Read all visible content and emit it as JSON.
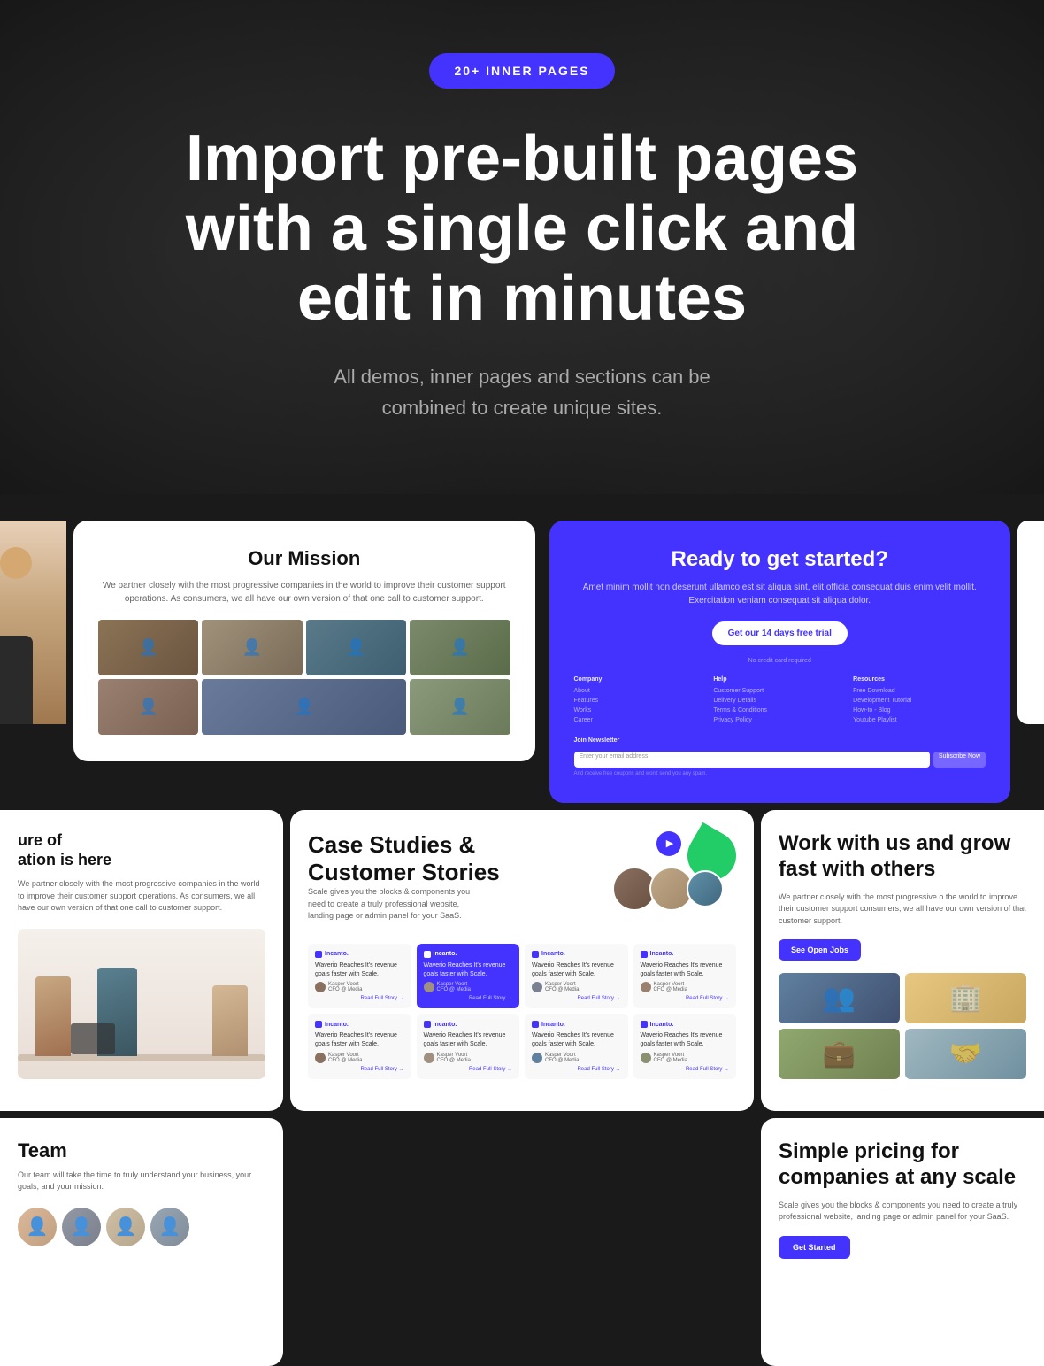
{
  "hero": {
    "badge": "20+ INNER PAGES",
    "title": "Import pre-built pages with a single click and edit in minutes",
    "subtitle": "All demos, inner pages and sections can be combined to create unique sites."
  },
  "card_mission": {
    "title": "Our Mission",
    "text": "We partner closely with the most progressive companies in the world to improve their customer support operations. As consumers, we all have our own version of that one call to customer support."
  },
  "card_ready": {
    "title": "Ready to get started?",
    "text": "Amet minim mollit non deserunt ullamco est sit aliqua sint, elit officia consequat duis enim velit mollit. Exercitation veniam consequat sit aliqua dolor.",
    "cta_button": "Get our 14 days free trial",
    "cta_sub": "No credit card required",
    "footer": {
      "company": {
        "header": "Company",
        "links": [
          "About",
          "Features",
          "Works",
          "Career"
        ]
      },
      "help": {
        "header": "Help",
        "links": [
          "Customer Support",
          "Delivery Details",
          "Terms & Conditions",
          "Privacy Policy"
        ]
      },
      "resources": {
        "header": "Resources",
        "links": [
          "Free Download",
          "Development Tutorial",
          "How-to - Blog",
          "Youtube Playlist"
        ]
      },
      "newsletter": {
        "header": "Join Newsletter",
        "placeholder": "Enter your email address",
        "button": "Subscribe Now",
        "note": "And receive free coupons and won't send you any spam."
      }
    }
  },
  "card_era": {
    "title": "ure of ation is here",
    "text": "We partner closely with the most progressive companies in the world to improve their customer support operations. As consumers, we all have our own version of that one call to customer support."
  },
  "card_case_studies": {
    "title": "Case Studies & Customer Stories",
    "desc": "Scale gives you the blocks & components you need to create a truly professional website, landing page or admin panel for your SaaS.",
    "testimonials": [
      {
        "brand": "Incanto.",
        "text": "Waverio Reaches It's revenue goals faster with Scale.",
        "author": "Kasper Voort",
        "role": "CFO @ Media",
        "read": "Read Full Story →",
        "highlighted": false
      },
      {
        "brand": "Incanto.",
        "text": "Waverio Reaches It's revenue goals faster with Scale.",
        "author": "Kasper Voort",
        "role": "CFO @ Media",
        "read": "Read Full Story →",
        "highlighted": true
      },
      {
        "brand": "Incanto.",
        "text": "Waverio Reaches It's revenue goals faster with Scale.",
        "author": "Kasper Voort",
        "role": "CFO @ Media",
        "read": "Read Full Story →",
        "highlighted": false
      },
      {
        "brand": "Incanto.",
        "text": "Waverio Reaches It's revenue goals faster with Scale.",
        "author": "Kasper Voort",
        "role": "CFO @ Media",
        "read": "Read Full Story →",
        "highlighted": false
      },
      {
        "brand": "Incanto.",
        "text": "Waverio Reaches It's revenue goals faster with Scale.",
        "author": "Kasper Voort",
        "role": "CFO @ Media",
        "read": "Read Full Story →",
        "highlighted": false
      },
      {
        "brand": "Incanto.",
        "text": "Waverio Reaches It's revenue goals faster with Scale.",
        "author": "Kasper Voort",
        "role": "CFO @ Media",
        "read": "Read Full Story →",
        "highlighted": false
      },
      {
        "brand": "Incanto.",
        "text": "Waverio Reaches It's revenue goals faster with Scale.",
        "author": "Kasper Voort",
        "role": "CFO @ Media",
        "read": "Read Full Story →",
        "highlighted": false
      },
      {
        "brand": "Incanto.",
        "text": "Waverio Reaches It's revenue goals faster with Scale.",
        "author": "Kasper Voort",
        "role": "CFO @ Media",
        "read": "Read Full Story →",
        "highlighted": false
      }
    ]
  },
  "card_work": {
    "title": "Work with us and grow fast with others",
    "text": "We partner closely with the most progressive o the world to improve their customer support consumers, we all have our own version of that customer support.",
    "button": "See Open Jobs"
  },
  "card_team": {
    "title": "Team",
    "text": "Our team will take the time to truly understand your business, your goals, and your mission."
  },
  "card_pricing": {
    "title": "Simple pricing for companies at any scale",
    "text": "Scale gives you the blocks & components you need to create a truly professional website, landing page or admin panel for your SaaS.",
    "button": "Get Started"
  }
}
